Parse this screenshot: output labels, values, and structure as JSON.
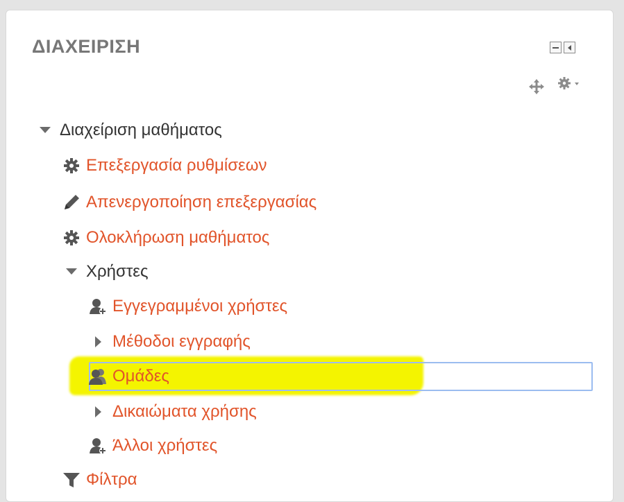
{
  "block": {
    "title": "ΔΙΑΧΕΙΡΙΣΗ",
    "controls": [
      "minimize-icon",
      "dock-icon",
      "move-icon",
      "gear-menu-icon"
    ]
  },
  "tree": {
    "course_admin": "Διαχείριση μαθήματος",
    "edit_settings": "Επεξεργασία ρυθμίσεων",
    "turn_editing_off": "Απενεργοποίηση επεξεργασίας",
    "course_completion": "Ολοκλήρωση μαθήματος",
    "users": "Χρήστες",
    "enrolled_users": "Εγγεγραμμένοι χρήστες",
    "enrolment_methods": "Μέθοδοι εγγραφής",
    "groups": "Ομάδες",
    "permissions": "Δικαιώματα χρήσης",
    "other_users": "Άλλοι χρήστες",
    "filters": "Φίλτρα"
  },
  "colors": {
    "link": "#e1542a",
    "text": "#333333",
    "highlight": "#f4f400",
    "focus": "#9bbcf0"
  }
}
